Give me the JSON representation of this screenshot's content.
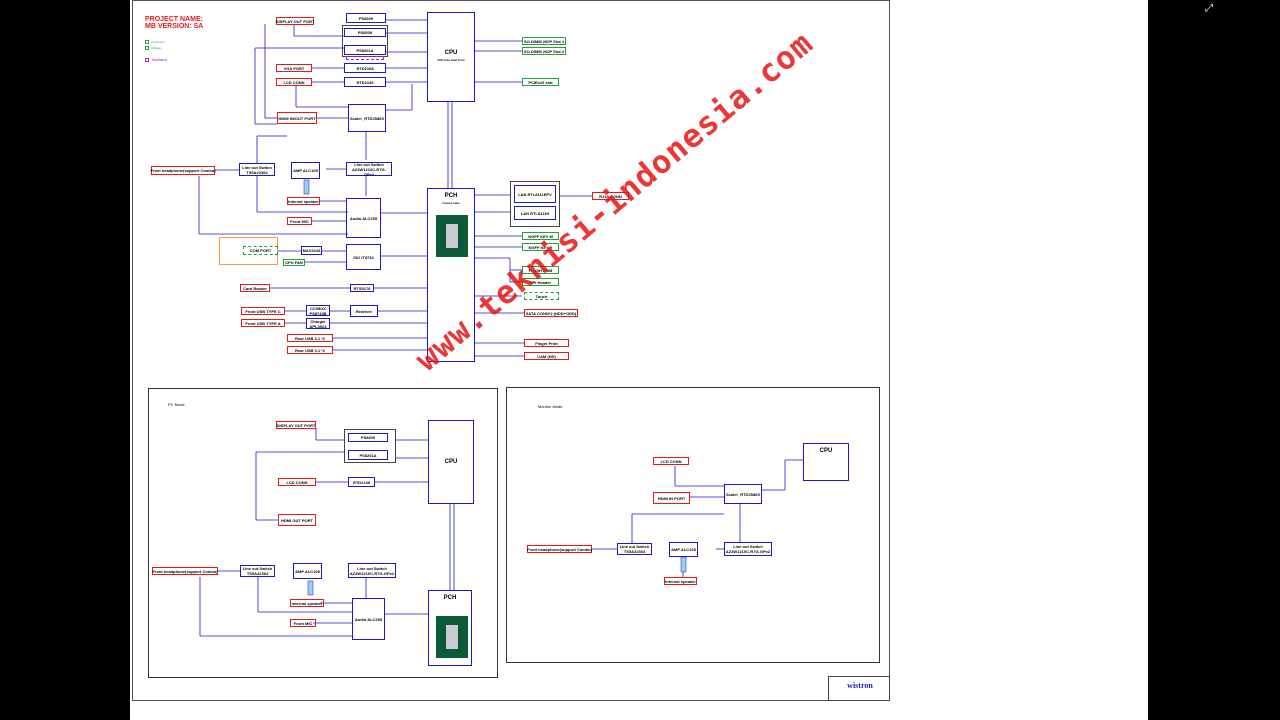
{
  "project": {
    "name_label": "PROJECT NAME:",
    "version_label": "MB VERSION: SA"
  },
  "watermark": "www.teknisi-indonesia.com",
  "brand": "wistron",
  "legend": [
    "Connector",
    "Chipset",
    "TestStamp"
  ],
  "main": {
    "cpu": {
      "title": "CPU",
      "desc": "14th Gen Intel Core"
    },
    "pch": {
      "title": "PCH",
      "desc": "Comet Lake"
    },
    "display_out": "DISPLAY OUT PORT",
    "ps8309": "PS8309",
    "ps8201a": "PS8201A",
    "vga_port": "VGA PORT",
    "rtd2168": "RTD2168",
    "lcd_conn": "LCD CONN",
    "rtd2136": "RTD2136",
    "hdmi_inout": "HDMI IN/OUT PORT",
    "scaler": "Scaler_RTD2586S",
    "so_dimm_1": "SO-DIMM 260P Slot 1",
    "so_dimm_2": "SO-DIMM 260P Slot 2",
    "pcie_slot": "PCIEx16 slot",
    "front_headphone": "Front headphone(support Combo)",
    "lineout_switch": "Line out Switch TS5A22364",
    "amp": "AMP ALC105",
    "lineout_switch2": "Line out Switch AZ4W1210C-R7G-GPx2",
    "internal_speaker": "Internal speaker",
    "front_mic": "Front MIC",
    "audio": "Audio ALC255",
    "com_port": "COM PORT",
    "max3243": "MAX3243",
    "cpu_fan": "CPU FAN",
    "sio": "SIO IT8732",
    "card_reader": "Card Reader",
    "rts5176": "RTS5176",
    "front_usb_c": "Front USB TYPE C",
    "front_usb_a": "Front USB TYPE A",
    "cc_mux": "CC/MUX PS8743B",
    "charger": "Charger APL3524",
    "redriver": "Redriver",
    "rear_usb_1": "Rear USB 3.1 *2",
    "rear_usb_2": "Rear USB 3.1 *2",
    "lan1": "LAN RTL8111EPV",
    "lan2": "LAN RTL8111H",
    "rj45": "RJ45 CONN",
    "ngff_wl": "NGFF KEY M",
    "ngff_e": "NGFF KEY E",
    "flash_rom": "FLASH ROM",
    "spi_header": "SPI Header",
    "touch": "Touch",
    "sata": "SATA CONN*2 (HDD+ODD)",
    "finger": "Finger Print",
    "cam": "CAM (HD)"
  },
  "pc_mode": {
    "label": "PC Mode",
    "display_out": "DISPLAY OUT PORT",
    "ps8309": "PS8309",
    "ps8201a": "PS8201A",
    "lcd_conn": "LCD CONN",
    "rtd2136": "RTD2136",
    "hdmi_out": "HDMI OUT PORT",
    "cpu": "CPU",
    "front_headphone": "Front headphone(support Combo)",
    "lineout_switch": "Line out Switch TS5A22364",
    "amp": "AMP ALC105",
    "lineout_switch2": "Line out Switch AZ4W1210C-R7G-GPx2",
    "internal_speaker": "Internal speaker",
    "front_mic": "Front MIC",
    "audio": "Audio ALC255",
    "pch": "PCH"
  },
  "monitor_mode": {
    "label": "Monitor Mode",
    "lcd_conn": "LCD CONN",
    "hdmi_in": "HDMI IN PORT",
    "scaler": "Scaler_RTD2586S",
    "cpu": "CPU",
    "front_headphone": "Front headphone(support Combo)",
    "lineout_switch": "Line out Switch TS5A22364",
    "amp": "AMP ALC105",
    "lineout_switch2": "Line out Switch AZ4W1210C-R7G-GPx2",
    "internal_speaker": "Internal speaker"
  }
}
